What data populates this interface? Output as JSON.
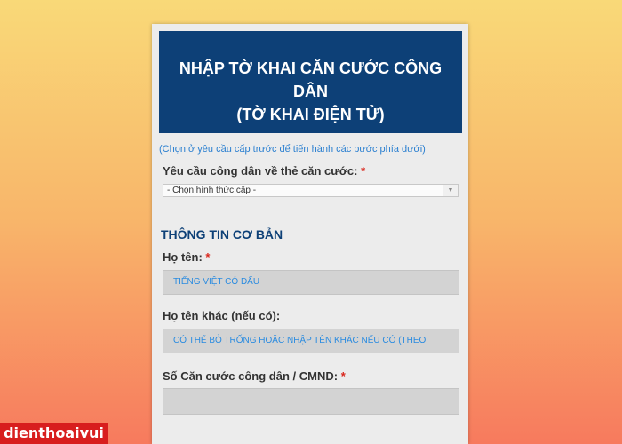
{
  "form": {
    "title_line1": "NHẬP TỜ KHAI CĂN CƯỚC CÔNG DÂN",
    "title_line2": "(TỜ KHAI ĐIỆN TỬ)",
    "hint": "(Chọn ở yêu cầu cấp trước để tiến hành các bước phía dưới)",
    "request_label": "Yêu cầu công dân về thẻ căn cước:",
    "required_mark": "*",
    "request_select_value": "- Chọn hình thức cấp -",
    "section_title": "THÔNG TIN CƠ BẢN",
    "fullname_label": "Họ tên:",
    "fullname_placeholder": "TIẾNG VIỆT CÓ DẤU",
    "othername_label": "Họ tên khác (nếu có):",
    "othername_placeholder": "CÓ THỂ BỎ TRỐNG HOẶC NHẬP TÊN KHÁC NẾU CÓ (THEO",
    "id_label": "Số Căn cước công dân / CMND:",
    "id_value": ""
  },
  "watermark": {
    "brand": "dienthoaivui"
  },
  "colors": {
    "header_bg": "#0d4077",
    "accent_blue": "#2a7fd0",
    "required_red": "#d9261c",
    "brand_red": "#d81e1e"
  },
  "icons": {
    "select_caret": "chevron-down-icon"
  }
}
